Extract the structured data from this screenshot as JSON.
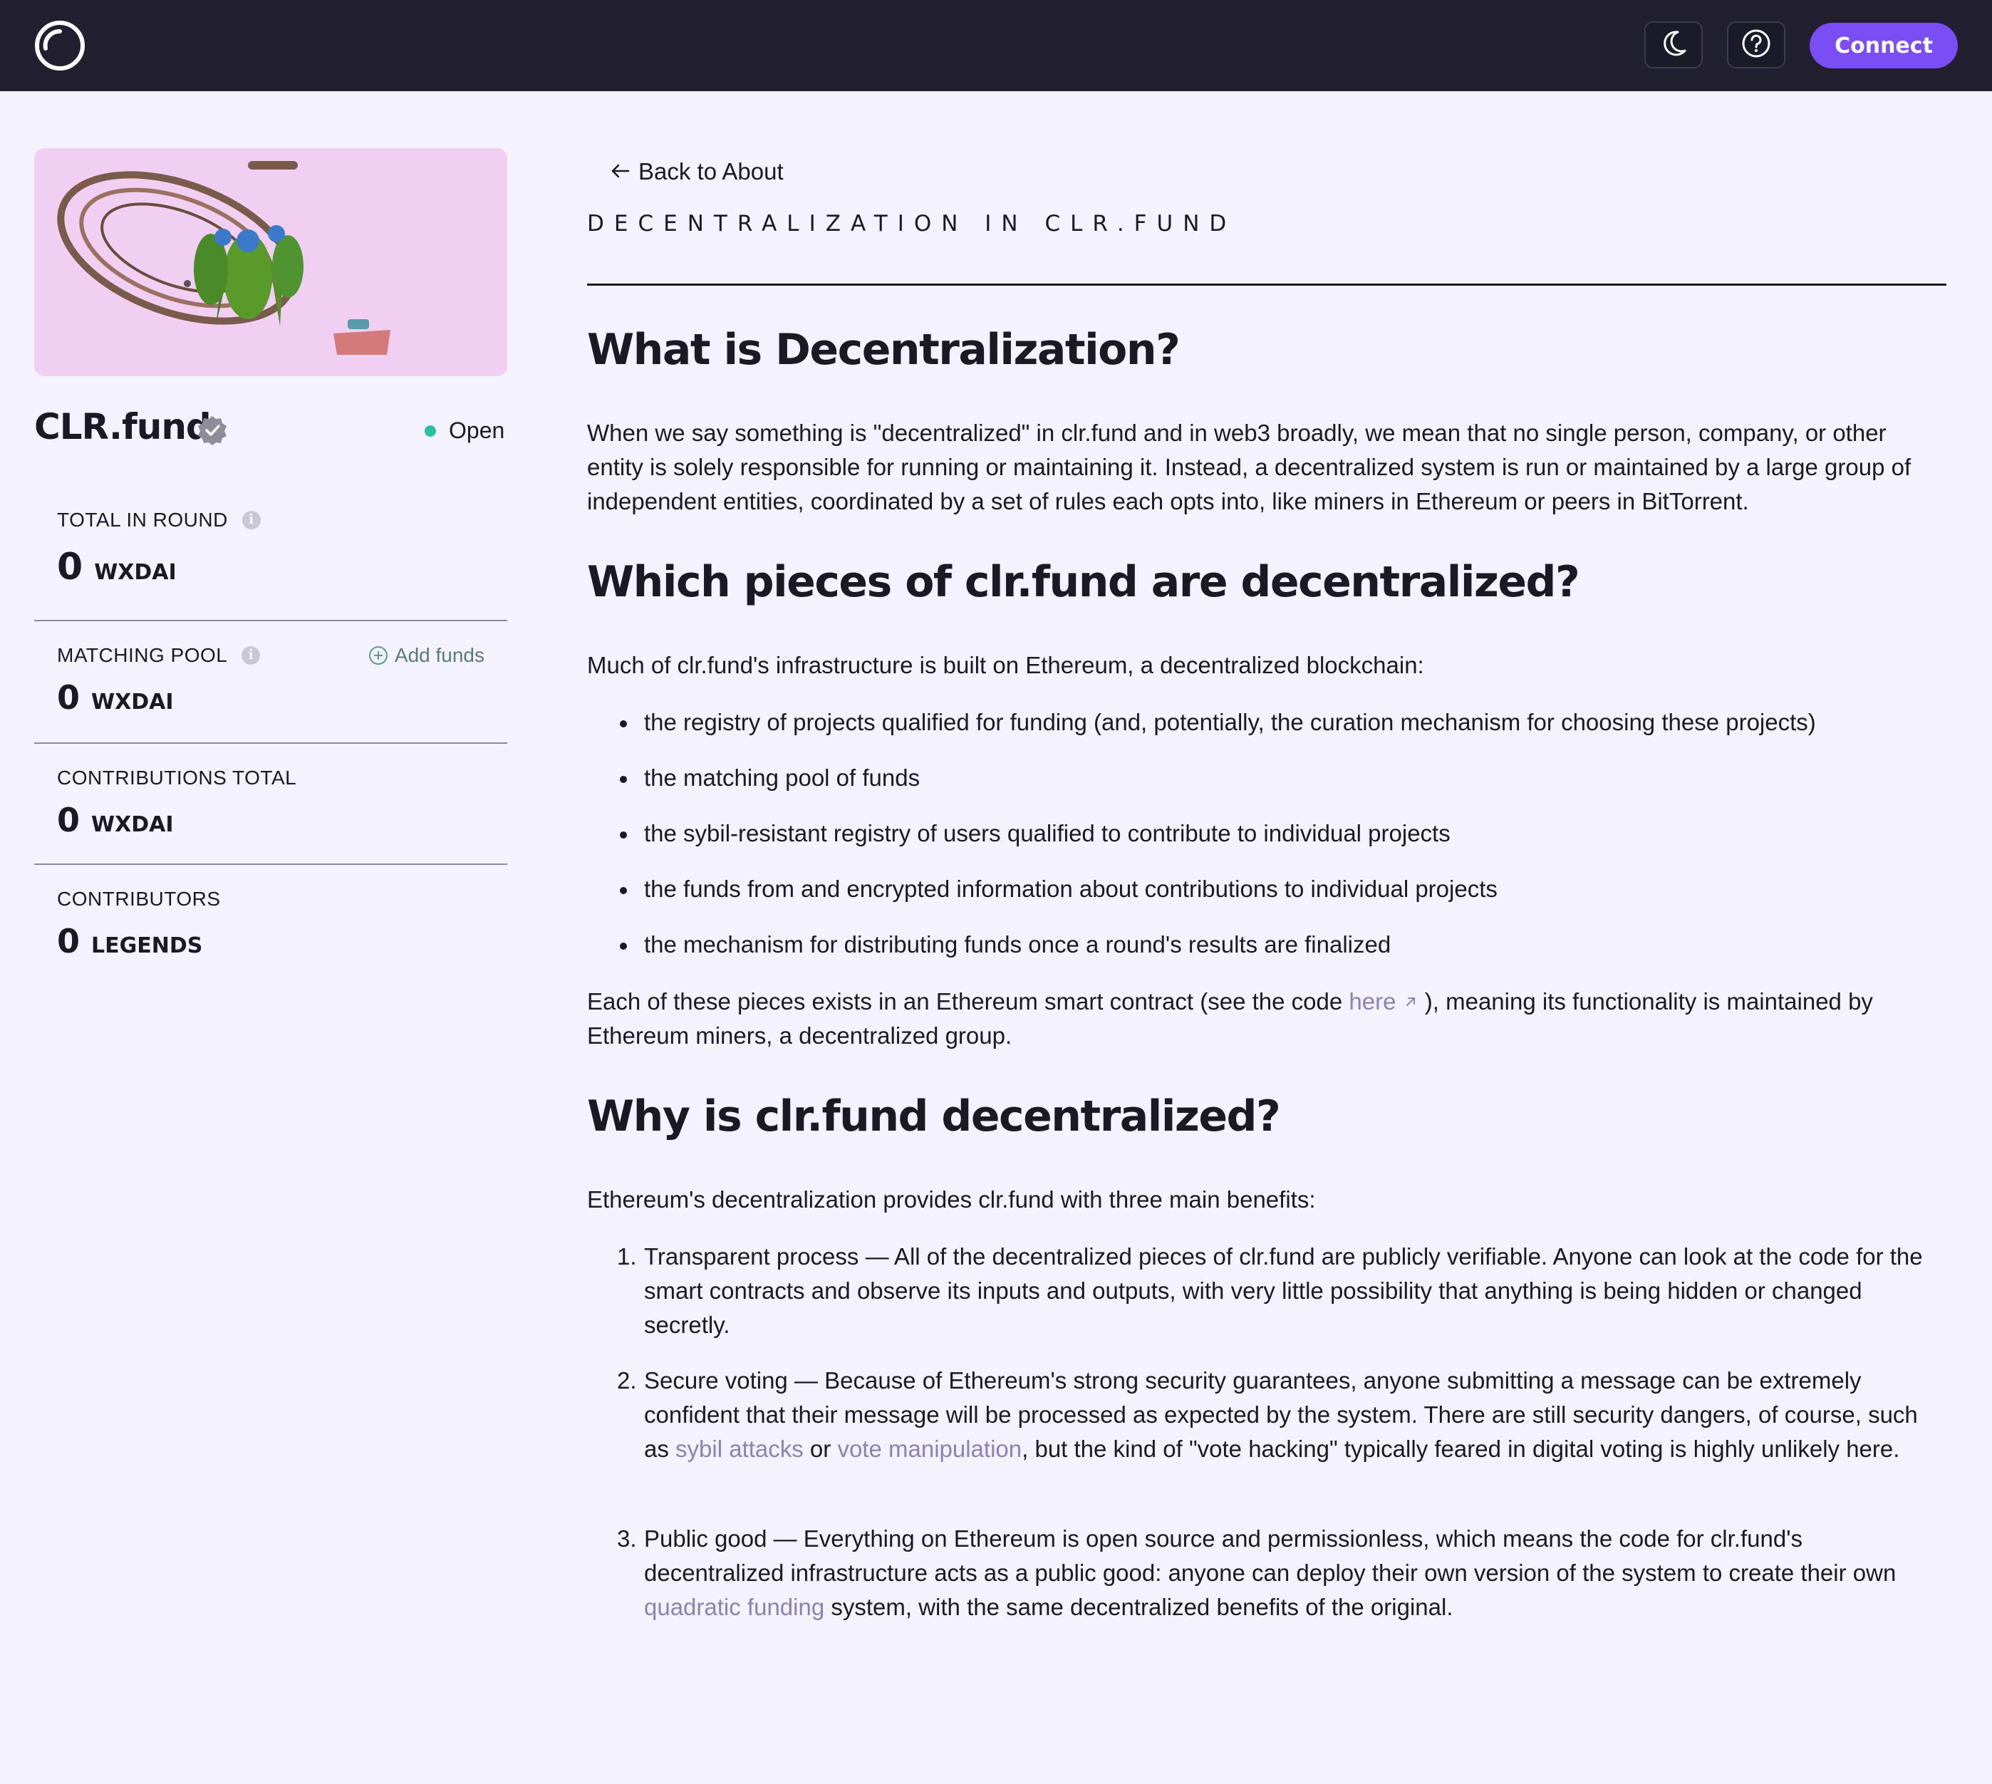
{
  "header": {
    "connect_label": "Connect",
    "icons": [
      "logo-icon",
      "moon-icon",
      "help-icon"
    ]
  },
  "sidebar": {
    "round_name": "CLR.fund",
    "status": "Open",
    "stats": [
      {
        "label": "TOTAL IN ROUND",
        "value": "0",
        "unit": "WXDAI"
      },
      {
        "label": "MATCHING POOL",
        "value": "0",
        "unit": "WXDAI",
        "action": "Add funds"
      },
      {
        "label": "CONTRIBUTIONS TOTAL",
        "value": "0",
        "unit": "WXDAI"
      },
      {
        "label": "CONTRIBUTORS",
        "value": "0",
        "unit": "LEGENDS"
      }
    ]
  },
  "main": {
    "back_label": "Back to About",
    "eyebrow": "DECENTRALIZATION IN CLR.FUND",
    "h1": "What is Decentralization?",
    "p1": "When we say something is \"decentralized\" in clr.fund and in web3 broadly, we mean that no single person, company, or other entity is solely responsible for running or maintaining it. Instead, a decentralized system is run or maintained by a large group of independent entities, coordinated by a set of rules each opts into, like miners in Ethereum or peers in BitTorrent.",
    "h2": "Which pieces of clr.fund are decentralized?",
    "p2": "Much of clr.fund's infrastructure is built on Ethereum, a decentralized blockchain:",
    "bullets": [
      "the registry of projects qualified for funding (and, potentially, the curation mechanism for choosing these projects)",
      "the matching pool of funds",
      "the sybil-resistant registry of users qualified to contribute to individual projects",
      "the funds from and encrypted information about contributions to individual projects",
      "the mechanism for distributing funds once a round's results are finalized"
    ],
    "p3_a": "Each of these pieces exists in an Ethereum smart contract (see the code ",
    "p3_link": "here",
    "p3_b": " ), meaning its functionality is maintained by Ethereum miners, a decentralized group.",
    "h3": "Why is clr.fund decentralized?",
    "p4": "Ethereum's decentralization provides clr.fund with three main benefits:",
    "ol": [
      {
        "n": "1.",
        "a": "Transparent process — All of the decentralized pieces of clr.fund are publicly verifiable. Anyone can look at the code for the smart contracts and observe its inputs and outputs, with very little possibility that anything is being hidden or changed secretly."
      },
      {
        "n": "2.",
        "a": "Secure voting — Because of Ethereum's strong security guarantees, anyone submitting a message can be extremely confident that their message will be processed as expected by the system. There are still security dangers, of course, such as ",
        "link1": "sybil attacks",
        "b": " or ",
        "link2": "vote manipulation",
        "c": ", but the kind of \"vote hacking\" typically feared in digital voting is highly unlikely here."
      },
      {
        "n": "3.",
        "a": "Public good — Everything on Ethereum is open source and permissionless, which means the code for clr.fund's decentralized infrastructure acts as a public good: anyone can deploy their own version of the system to create their own ",
        "link1": "quadratic funding",
        "b": " system, with the same decentralized benefits of the original."
      }
    ]
  }
}
